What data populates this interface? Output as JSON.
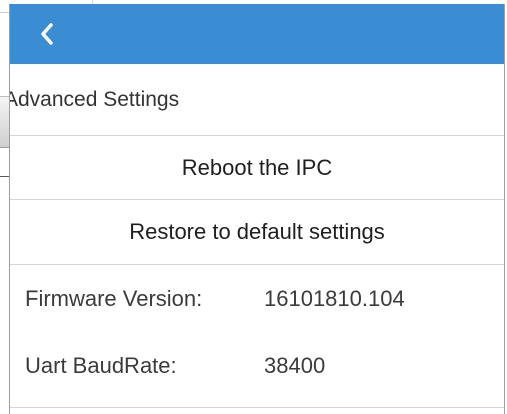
{
  "header": {
    "back_icon": "chevron-left-icon",
    "background_color": "#3a8dd2"
  },
  "section": {
    "title": "Advanced Settings"
  },
  "actions": {
    "reboot_label": "Reboot the IPC",
    "restore_label": "Restore to default settings"
  },
  "info": {
    "firmware_label": "Firmware Version:",
    "firmware_value": "16101810.104",
    "baud_label": "Uart BaudRate:",
    "baud_value": "38400"
  }
}
